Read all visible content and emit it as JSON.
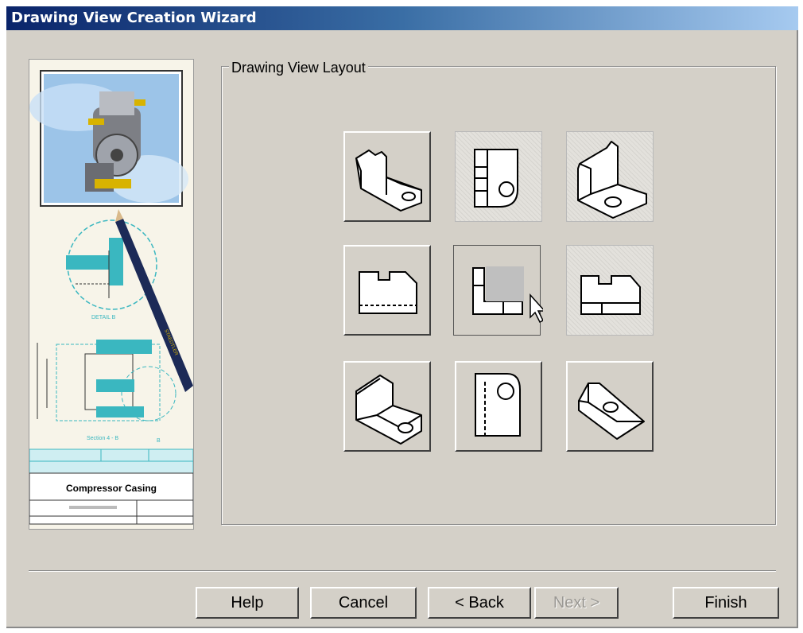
{
  "window": {
    "title": "Drawing View Creation Wizard"
  },
  "preview": {
    "detail_label": "DETAIL B",
    "section_label": "Section 4 - B",
    "section_marker": "B",
    "part_title": "Compressor Casing",
    "pencil_brand": "STAEDTLER"
  },
  "layout_group": {
    "label": "Drawing View Layout"
  },
  "views": [
    {
      "name": "isometric-view",
      "state": "normal"
    },
    {
      "name": "side-view",
      "state": "hatched"
    },
    {
      "name": "isometric-view-2",
      "state": "hatched"
    },
    {
      "name": "front-view",
      "state": "normal"
    },
    {
      "name": "standard-3-view",
      "state": "selected"
    },
    {
      "name": "front-with-section",
      "state": "hatched"
    },
    {
      "name": "isometric-view-3",
      "state": "normal"
    },
    {
      "name": "right-view",
      "state": "normal"
    },
    {
      "name": "isometric-view-4",
      "state": "normal"
    }
  ],
  "buttons": {
    "help": "Help",
    "cancel": "Cancel",
    "back": "< Back",
    "next": "Next >",
    "finish": "Finish"
  },
  "colors": {
    "accent": "#3ab7c0",
    "title_start": "#0a246a",
    "title_end": "#a6caf0"
  }
}
